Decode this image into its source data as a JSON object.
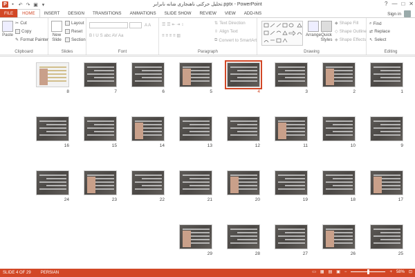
{
  "window": {
    "title": "تحلیل حرکتی ناهنجاری شانه نابرابر.pptx - PowerPoint",
    "app_icon": "P",
    "controls": [
      "?",
      "—",
      "□",
      "✕"
    ]
  },
  "ribbon_tabs": [
    "FILE",
    "HOME",
    "INSERT",
    "DESIGN",
    "TRANSITIONS",
    "ANIMATIONS",
    "SLIDE SHOW",
    "REVIEW",
    "VIEW",
    "ADD-INS"
  ],
  "active_tab": "HOME",
  "account": {
    "sign_in": "Sign in"
  },
  "clipboard": {
    "paste": "Paste",
    "cut": "Cut",
    "copy": "Copy",
    "format_painter": "Format Painter",
    "label": "Clipboard"
  },
  "slides_group": {
    "new_slide": "New Slide",
    "layout": "Layout",
    "reset": "Reset",
    "section": "Section",
    "label": "Slides"
  },
  "font_group": {
    "label": "Font"
  },
  "paragraph_group": {
    "text_direction": "Text Direction",
    "align_text": "Align Text",
    "smartart": "Convert to SmartArt",
    "label": "Paragraph"
  },
  "drawing_group": {
    "arrange": "Arrange",
    "quick_styles": "Quick Styles",
    "shape_fill": "Shape Fill",
    "shape_outline": "Shape Outline",
    "shape_effects": "Shape Effects",
    "label": "Drawing"
  },
  "editing_group": {
    "find": "Find",
    "replace": "Replace",
    "select": "Select",
    "label": "Editing"
  },
  "slides": [
    {
      "n": "1",
      "style": "dark"
    },
    {
      "n": "2",
      "style": "dark"
    },
    {
      "n": "3",
      "style": "dark"
    },
    {
      "n": "4",
      "style": "dark",
      "selected": true
    },
    {
      "n": "5",
      "style": "dark"
    },
    {
      "n": "6",
      "style": "dark"
    },
    {
      "n": "7",
      "style": "dark"
    },
    {
      "n": "8",
      "style": "light"
    },
    {
      "n": "9",
      "style": "dark"
    },
    {
      "n": "10",
      "style": "dark"
    },
    {
      "n": "11",
      "style": "dark"
    },
    {
      "n": "12",
      "style": "dark"
    },
    {
      "n": "13",
      "style": "dark"
    },
    {
      "n": "14",
      "style": "dark"
    },
    {
      "n": "15",
      "style": "dark"
    },
    {
      "n": "16",
      "style": "dark"
    },
    {
      "n": "17",
      "style": "dark"
    },
    {
      "n": "18",
      "style": "dark"
    },
    {
      "n": "19",
      "style": "dark"
    },
    {
      "n": "20",
      "style": "dark"
    },
    {
      "n": "21",
      "style": "dark"
    },
    {
      "n": "22",
      "style": "dark"
    },
    {
      "n": "23",
      "style": "dark"
    },
    {
      "n": "24",
      "style": "dark"
    },
    {
      "n": "25",
      "style": "dark"
    },
    {
      "n": "26",
      "style": "dark"
    },
    {
      "n": "27",
      "style": "dark"
    },
    {
      "n": "28",
      "style": "dark"
    },
    {
      "n": "29",
      "style": "dark"
    }
  ],
  "status": {
    "slide_info": "SLIDE 4 OF 29",
    "language": "PERSIAN",
    "zoom": "58%"
  },
  "colors": {
    "accent": "#d24726",
    "thumb_dark": "#55524f"
  }
}
